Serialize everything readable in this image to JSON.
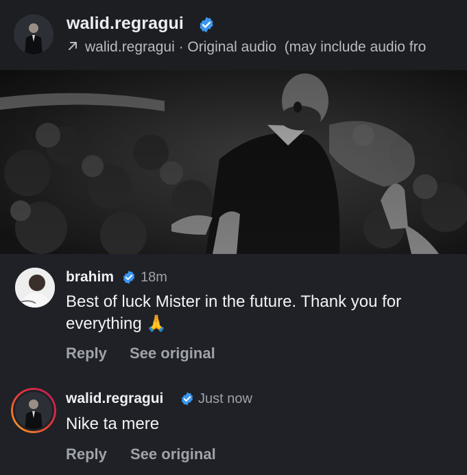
{
  "header": {
    "username": "walid.regragui",
    "audio_user": "walid.regragui",
    "audio_separator": " · ",
    "audio_title": "Original audio",
    "audio_note": "(may include audio fro"
  },
  "comments": [
    {
      "username": "brahim",
      "time": "18m",
      "text_line1": "Best of luck Mister in the future. Thank you for",
      "text_line2": "everything",
      "emoji": "🙏",
      "reply_label": "Reply",
      "see_original_label": "See original"
    },
    {
      "username": "walid.regragui",
      "time": "Just now",
      "text": "Nike ta mere",
      "reply_label": "Reply",
      "see_original_label": "See original"
    }
  ],
  "colors": {
    "background": "#1f2126",
    "verified_badge": "#3b97f0",
    "secondary_text": "#9fa3aa",
    "story_ring_start": "#f9a825",
    "story_ring_end": "#c2185b"
  },
  "icons": [
    "verified-badge-icon",
    "arrow-up-right-icon",
    "folded-hands-emoji"
  ]
}
